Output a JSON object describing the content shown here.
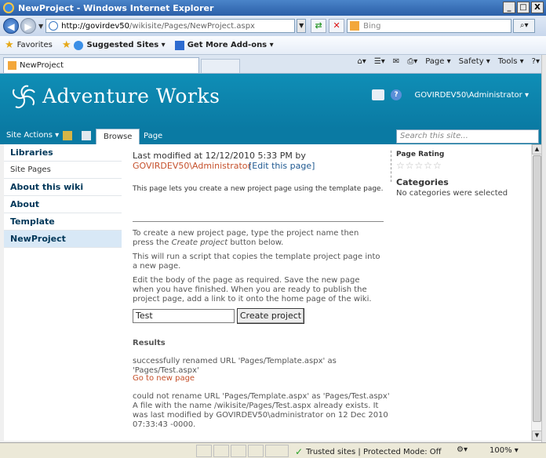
{
  "window": {
    "title": "NewProject - Windows Internet Explorer",
    "minimize": "_",
    "maximize": "□",
    "close": "X"
  },
  "address": {
    "url_domain": "http://govirdev50",
    "url_path": "/wikisite/Pages/NewProject.aspx",
    "search_placeholder": "Bing"
  },
  "favorites": {
    "label": "Favorites",
    "items": [
      {
        "label": "Suggested Sites ▾"
      },
      {
        "label": "Get More Add-ons ▾"
      }
    ]
  },
  "tab": {
    "label": "NewProject"
  },
  "commands": [
    "Page ▾",
    "Safety ▾",
    "Tools ▾"
  ],
  "site": {
    "title": "Adventure Works",
    "user": "GOVIRDEV50\\Administrator ▾",
    "help_icon": "?"
  },
  "ribbon": {
    "site_actions": "Site Actions ▾",
    "tabs": [
      "Browse",
      "Page"
    ],
    "search_placeholder": "Search this site..."
  },
  "leftnav": [
    {
      "label": "Libraries"
    },
    {
      "label": "Site Pages"
    },
    {
      "label": "About this wiki"
    },
    {
      "label": "About"
    },
    {
      "label": "Template"
    },
    {
      "label": "NewProject"
    }
  ],
  "content": {
    "last_modified": "Last modified at 12/12/2010 5:33 PM by",
    "modified_by": "GOVIRDEV50\\Administrator",
    "edit_link": "[Edit this page]",
    "intro": "This page lets you create a new project page using the template page.",
    "para1_a": "To create a new project page, type the project name then press the ",
    "para1_em": "Create project",
    "para1_b": " button below.",
    "para2": "This will run a script that copies the template project page into a new page.",
    "para3": "Edit the body of the page as required. Save the new page when you have finished. When you are ready to publish the project page, add a link to it onto the home page of the wiki.",
    "project_name_value": "Test",
    "create_button": "Create project",
    "results_heading": "Results",
    "result1": "successfully renamed URL 'Pages/Template.aspx' as 'Pages/Test.aspx'",
    "go_link": "Go to new page",
    "result2": "could not rename URL 'Pages/Template.aspx' as 'Pages/Test.aspx' A file with the name /wikisite/Pages/Test.aspx already exists. It was last modified by GOVIRDEV50\\administrator on 12 Dec 2010 07:33:43 -0000."
  },
  "sidebar_right": {
    "rating_heading": "Page Rating",
    "stars": "☆☆☆☆☆",
    "categories_heading": "Categories",
    "categories_value": "No categories were selected"
  },
  "status": {
    "trusted": "Trusted sites | Protected Mode: Off",
    "zoom": "100% ▾"
  }
}
